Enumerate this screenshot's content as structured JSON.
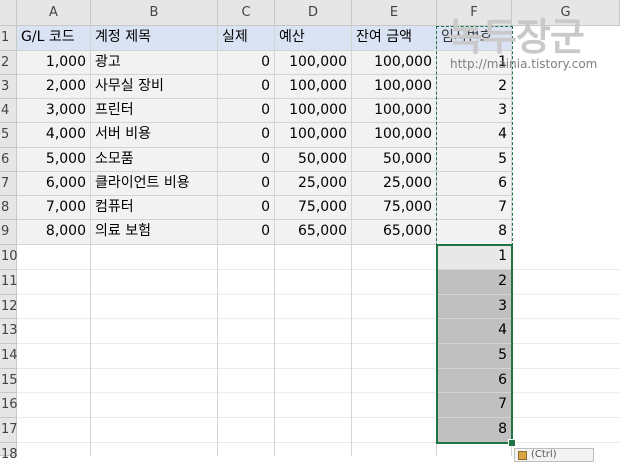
{
  "columns": [
    "A",
    "B",
    "C",
    "D",
    "E",
    "F",
    "G"
  ],
  "rows": [
    "1",
    "2",
    "3",
    "4",
    "5",
    "6",
    "7",
    "8",
    "9",
    "10",
    "11",
    "12",
    "13",
    "14",
    "15",
    "16",
    "17",
    "18"
  ],
  "table_header": {
    "gl_code": "G/L 코드",
    "account": "계정 제목",
    "actual": "실제",
    "budget": "예산",
    "remaining": "잔여 금액",
    "temp_no": "임시번호"
  },
  "table_rows": [
    {
      "gl_code": "1,000",
      "account": "광고",
      "actual": "0",
      "budget": "100,000",
      "remaining": "100,000",
      "temp_no": "1"
    },
    {
      "gl_code": "2,000",
      "account": "사무실 장비",
      "actual": "0",
      "budget": "100,000",
      "remaining": "100,000",
      "temp_no": "2"
    },
    {
      "gl_code": "3,000",
      "account": "프린터",
      "actual": "0",
      "budget": "100,000",
      "remaining": "100,000",
      "temp_no": "3"
    },
    {
      "gl_code": "4,000",
      "account": "서버 비용",
      "actual": "0",
      "budget": "100,000",
      "remaining": "100,000",
      "temp_no": "4"
    },
    {
      "gl_code": "5,000",
      "account": "소모품",
      "actual": "0",
      "budget": "50,000",
      "remaining": "50,000",
      "temp_no": "5"
    },
    {
      "gl_code": "6,000",
      "account": "클라이언트 비용",
      "actual": "0",
      "budget": "25,000",
      "remaining": "25,000",
      "temp_no": "6"
    },
    {
      "gl_code": "7,000",
      "account": "컴퓨터",
      "actual": "0",
      "budget": "75,000",
      "remaining": "75,000",
      "temp_no": "7"
    },
    {
      "gl_code": "8,000",
      "account": "의료 보험",
      "actual": "0",
      "budget": "65,000",
      "remaining": "65,000",
      "temp_no": "8"
    }
  ],
  "pasted_values": [
    "1",
    "2",
    "3",
    "4",
    "5",
    "6",
    "7",
    "8"
  ],
  "watermark": {
    "title": "녹두장군",
    "url": "http://mainia.tistory.com"
  },
  "paste_options_label": "(Ctrl)",
  "colors": {
    "selection_border": "#217346",
    "table_header_bg": "#dae3f3",
    "table_body_bg": "#f2f2f2",
    "selected_fill": "#c0c0c0"
  }
}
